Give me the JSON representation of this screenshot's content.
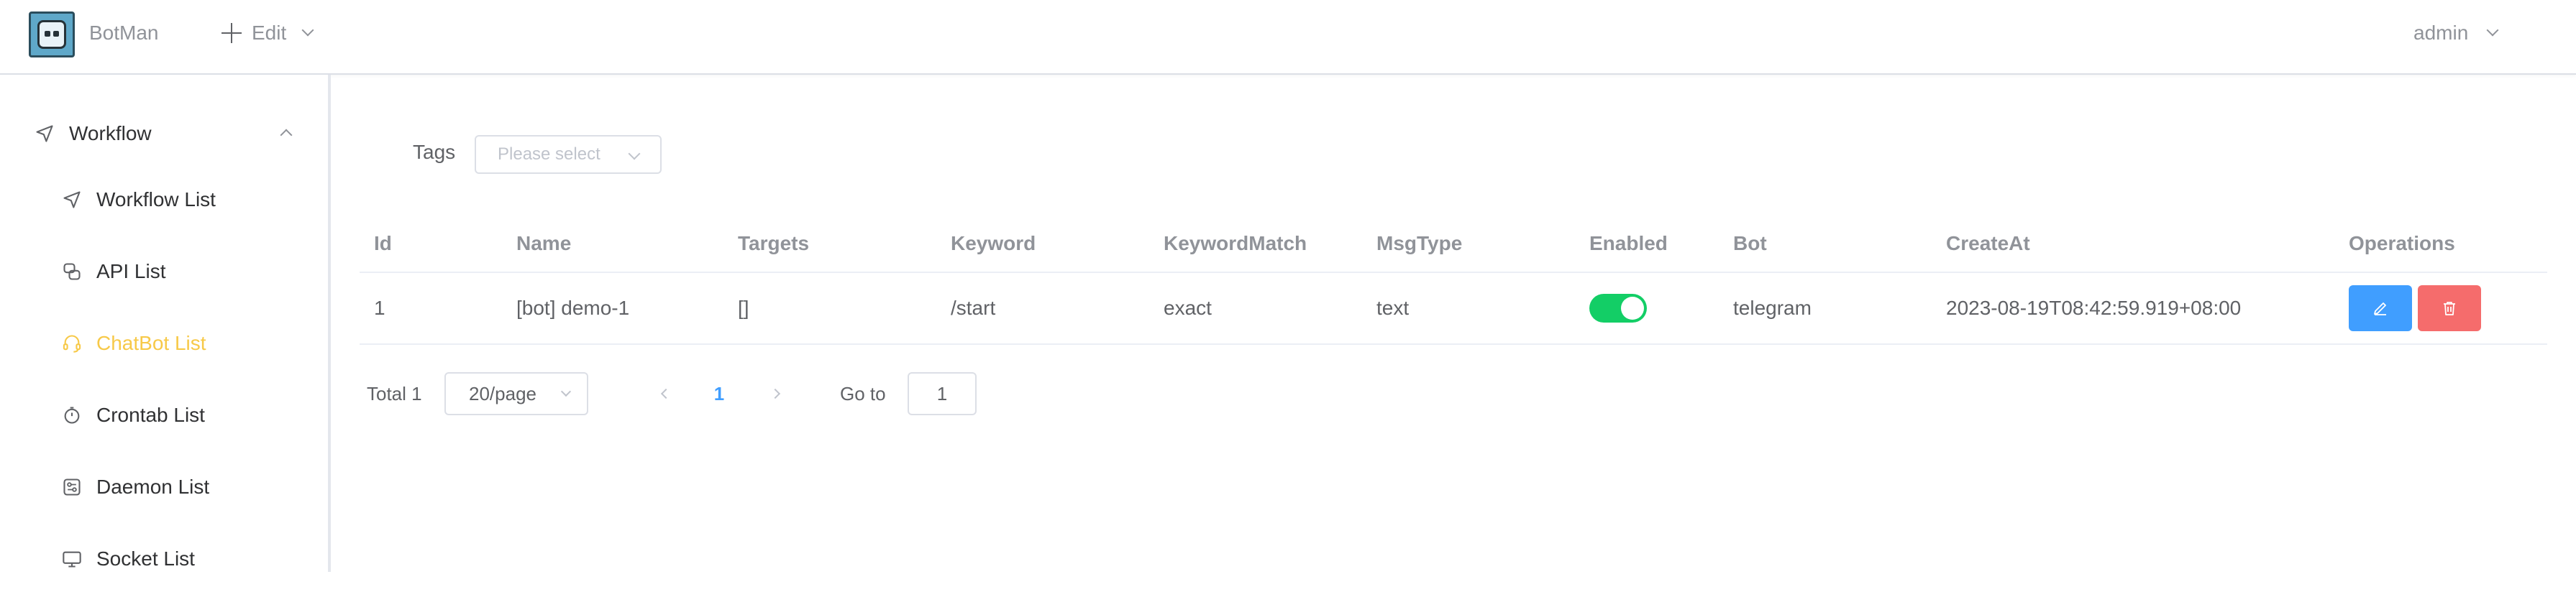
{
  "header": {
    "app_name": "BotMan",
    "edit_label": "Edit",
    "user_label": "admin"
  },
  "sidebar": {
    "group_label": "Workflow",
    "items": [
      {
        "label": "Workflow List",
        "icon": "navigation-icon",
        "active": false
      },
      {
        "label": "API List",
        "icon": "api-icon",
        "active": false
      },
      {
        "label": "ChatBot List",
        "icon": "headset-icon",
        "active": true
      },
      {
        "label": "Crontab List",
        "icon": "timer-icon",
        "active": false
      },
      {
        "label": "Daemon List",
        "icon": "daemon-icon",
        "active": false
      },
      {
        "label": "Socket List",
        "icon": "monitor-icon",
        "active": false
      }
    ]
  },
  "filter": {
    "tags_label": "Tags",
    "tags_placeholder": "Please select"
  },
  "table": {
    "columns": [
      "Id",
      "Name",
      "Targets",
      "Keyword",
      "KeywordMatch",
      "MsgType",
      "Enabled",
      "Bot",
      "CreateAt",
      "Operations"
    ],
    "rows": [
      {
        "id": "1",
        "name": "[bot] demo-1",
        "targets": "[]",
        "keyword": "/start",
        "keyword_match": "exact",
        "msg_type": "text",
        "enabled": true,
        "bot": "telegram",
        "create_at": "2023-08-19T08:42:59.919+08:00"
      }
    ]
  },
  "pagination": {
    "total": "Total 1",
    "page_size": "20/page",
    "current_page": "1",
    "goto_label": "Go to",
    "goto_value": "1"
  },
  "colors": {
    "active_menu": "#f7c948",
    "edit_button": "#409eff",
    "delete_button": "#f56c6c",
    "switch_on": "#13ce66",
    "page_active": "#409eff"
  }
}
